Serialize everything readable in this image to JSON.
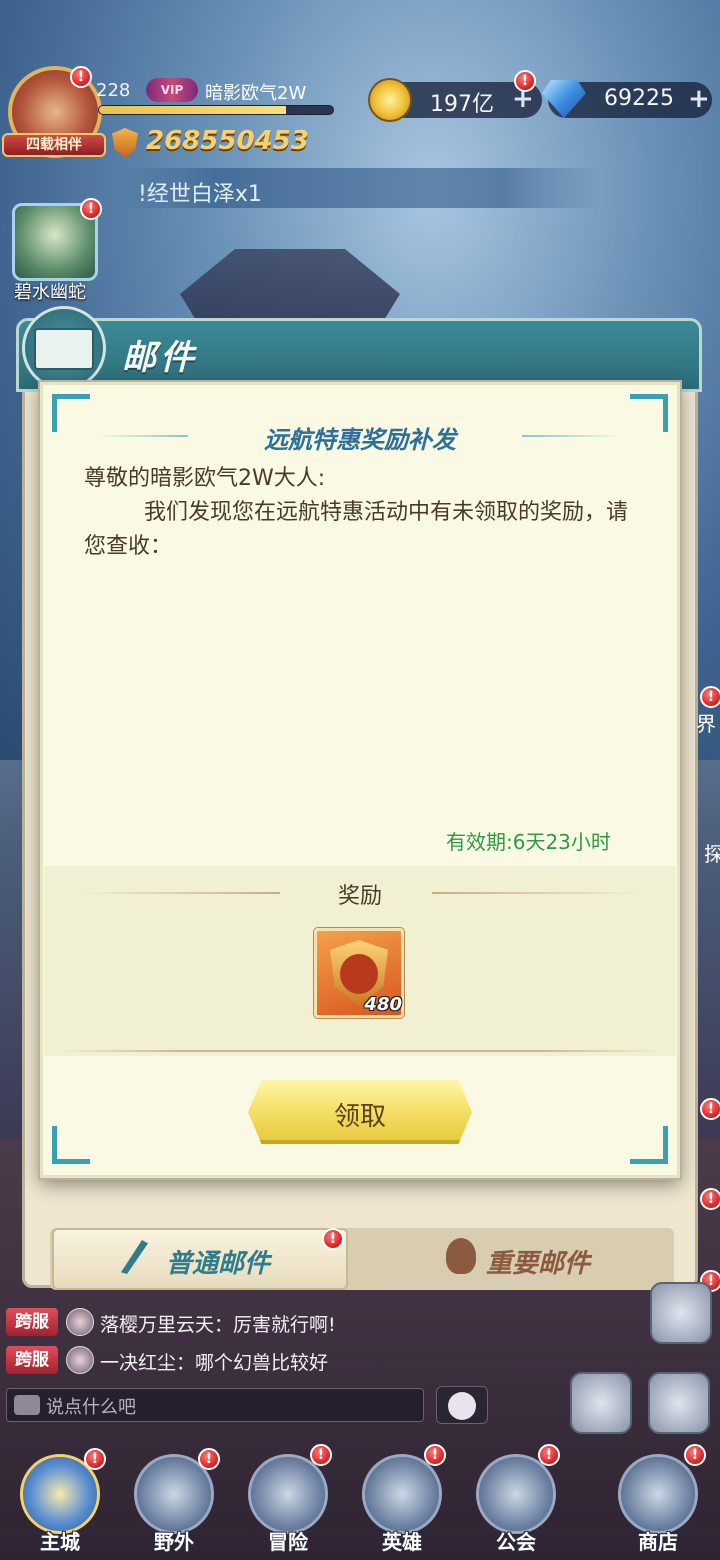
{
  "player": {
    "level": "228",
    "vip": "VIP",
    "name": "暗影欧气2W",
    "exp_fraction": 0.8,
    "avatar_tag": "四载相伴",
    "power": "268550453"
  },
  "currency": {
    "gold": "197亿",
    "gems": "69225",
    "plus": "+"
  },
  "ticker": {
    "text": "!经世白泽x1"
  },
  "pet": {
    "label": "碧水幽蛇"
  },
  "mail_panel": {
    "title": "邮件",
    "tabs": [
      {
        "label": "普通邮件",
        "icon": "quill-icon",
        "active": true
      },
      {
        "label": "重要邮件",
        "icon": "hot-air-balloon-icon",
        "active": false
      }
    ]
  },
  "dialog": {
    "title": "远航特惠奖励补发",
    "greeting": "尊敬的暗影欧气2W大人:",
    "body": "我们发现您在远航特惠活动中有未领取的奖励，请您查收：",
    "validity": "有效期:6天23小时",
    "reward_heading": "奖励",
    "reward_item": {
      "icon": "sword-shield-emblem-icon",
      "quantity": "480"
    },
    "claim_label": "领取"
  },
  "chat": {
    "messages": [
      {
        "channel": "跨服",
        "text": "落樱万里云天：厉害就行啊!"
      },
      {
        "channel": "跨服",
        "text": "一决红尘：哪个幻兽比较好"
      }
    ],
    "placeholder": "说点什么吧"
  },
  "nav": [
    {
      "label": "主城",
      "icon": "castle-icon",
      "active": true
    },
    {
      "label": "野外",
      "icon": "field-icon",
      "active": false
    },
    {
      "label": "冒险",
      "icon": "adventure-icon",
      "active": false
    },
    {
      "label": "英雄",
      "icon": "helmet-icon",
      "active": false
    },
    {
      "label": "公会",
      "icon": "guild-icon",
      "active": false
    },
    {
      "label": "商店",
      "icon": "shop-icon",
      "active": false
    }
  ],
  "side_labels": {
    "world": "界",
    "explore": "探"
  },
  "badge": "!",
  "colors": {
    "dialog_title": "#2e6f9c",
    "validity": "#2f9a44",
    "notification": "#d91d1d",
    "claim_button": "#f5e16a"
  }
}
